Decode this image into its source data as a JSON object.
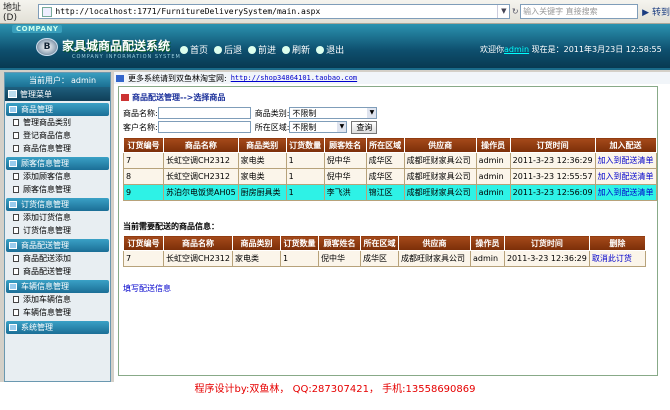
{
  "browser": {
    "address_label": "地址(D)",
    "url": "http://localhost:1771/FurnitureDeliverySystem/main.aspx",
    "search_placeholder": "输入关键字 直接搜索",
    "go_label": "转到"
  },
  "header": {
    "company": "COMPANY",
    "logo_text": "B",
    "title": "家具城商品配送系统",
    "subtitle": "COMPANY INFORMATION SYSTEM",
    "nav": [
      "首页",
      "后退",
      "前进",
      "刷新",
      "退出"
    ],
    "welcome_prefix": "欢迎你",
    "welcome_user": "admin",
    "date_text": "现在是：2011年3月23日 12:58:55"
  },
  "sidebar": {
    "current_user_label": "当前用户：",
    "current_user": "admin",
    "menu_title": "管理菜单",
    "groups": [
      {
        "label": "商品管理",
        "items": [
          "管理商品类别",
          "登记商品信息",
          "商品信息管理"
        ]
      },
      {
        "label": "顾客信息管理",
        "items": [
          "添加顾客信息",
          "顾客信息管理"
        ]
      },
      {
        "label": "订货信息管理",
        "items": [
          "添加订货信息",
          "订货信息管理"
        ]
      },
      {
        "label": "商品配送管理",
        "items": [
          "商品配送添加",
          "商品配送管理"
        ]
      },
      {
        "label": "车辆信息管理",
        "items": [
          "添加车辆信息",
          "车辆信息管理"
        ]
      },
      {
        "label": "系统管理",
        "items": []
      }
    ]
  },
  "main": {
    "announce_text": "更多系统请到双鱼林淘宝网:",
    "announce_link": "http://shop34864101.taobao.com",
    "breadcrumb": "商品配送管理-->选择商品",
    "form": {
      "name_label": "商品名称:",
      "category_label": "商品类别:",
      "category_value": "不限制",
      "customer_label": "客户名称:",
      "area_label": "所在区域:",
      "area_value": "不限制",
      "query_button": "查询"
    },
    "orders_table": {
      "headers": [
        "订货编号",
        "商品名称",
        "商品类别",
        "订货数量",
        "顾客姓名",
        "所在区域",
        "供应商",
        "操作员",
        "订货时间",
        "加入配送"
      ],
      "rows": [
        [
          "7",
          "长虹空调CH2312",
          "家电类",
          "1",
          "倪中华",
          "成华区",
          "成都旺财家具公司",
          "admin",
          "2011-3-23 12:36:29",
          "加入到配送清单"
        ],
        [
          "8",
          "长虹空调CH2312",
          "家电类",
          "1",
          "倪中华",
          "成华区",
          "成都旺财家具公司",
          "admin",
          "2011-3-23 12:55:57",
          "加入到配送清单"
        ],
        [
          "9",
          "苏泊尔电饭煲AH05",
          "厨房厨具类",
          "1",
          "李飞洪",
          "锦江区",
          "成都旺财家具公司",
          "admin",
          "2011-3-23 12:56:09",
          "加入到配送清单"
        ]
      ],
      "highlight_row": 2
    },
    "delivery_title": "当前需要配送的商品信息：",
    "delivery_table": {
      "headers": [
        "订货编号",
        "商品名称",
        "商品类别",
        "订货数量",
        "顾客姓名",
        "所在区域",
        "供应商",
        "操作员",
        "订货时间",
        "删除"
      ],
      "rows": [
        [
          "7",
          "长虹空调CH2312",
          "家电类",
          "1",
          "倪中华",
          "成华区",
          "成都旺财家具公司",
          "admin",
          "2011-3-23 12:36:29",
          "取消此订货"
        ]
      ]
    },
    "fill_link": "填写配送信息"
  },
  "footer": {
    "text": "程序设计by:双鱼林， QQ:287307421， 手机:13558690869"
  }
}
